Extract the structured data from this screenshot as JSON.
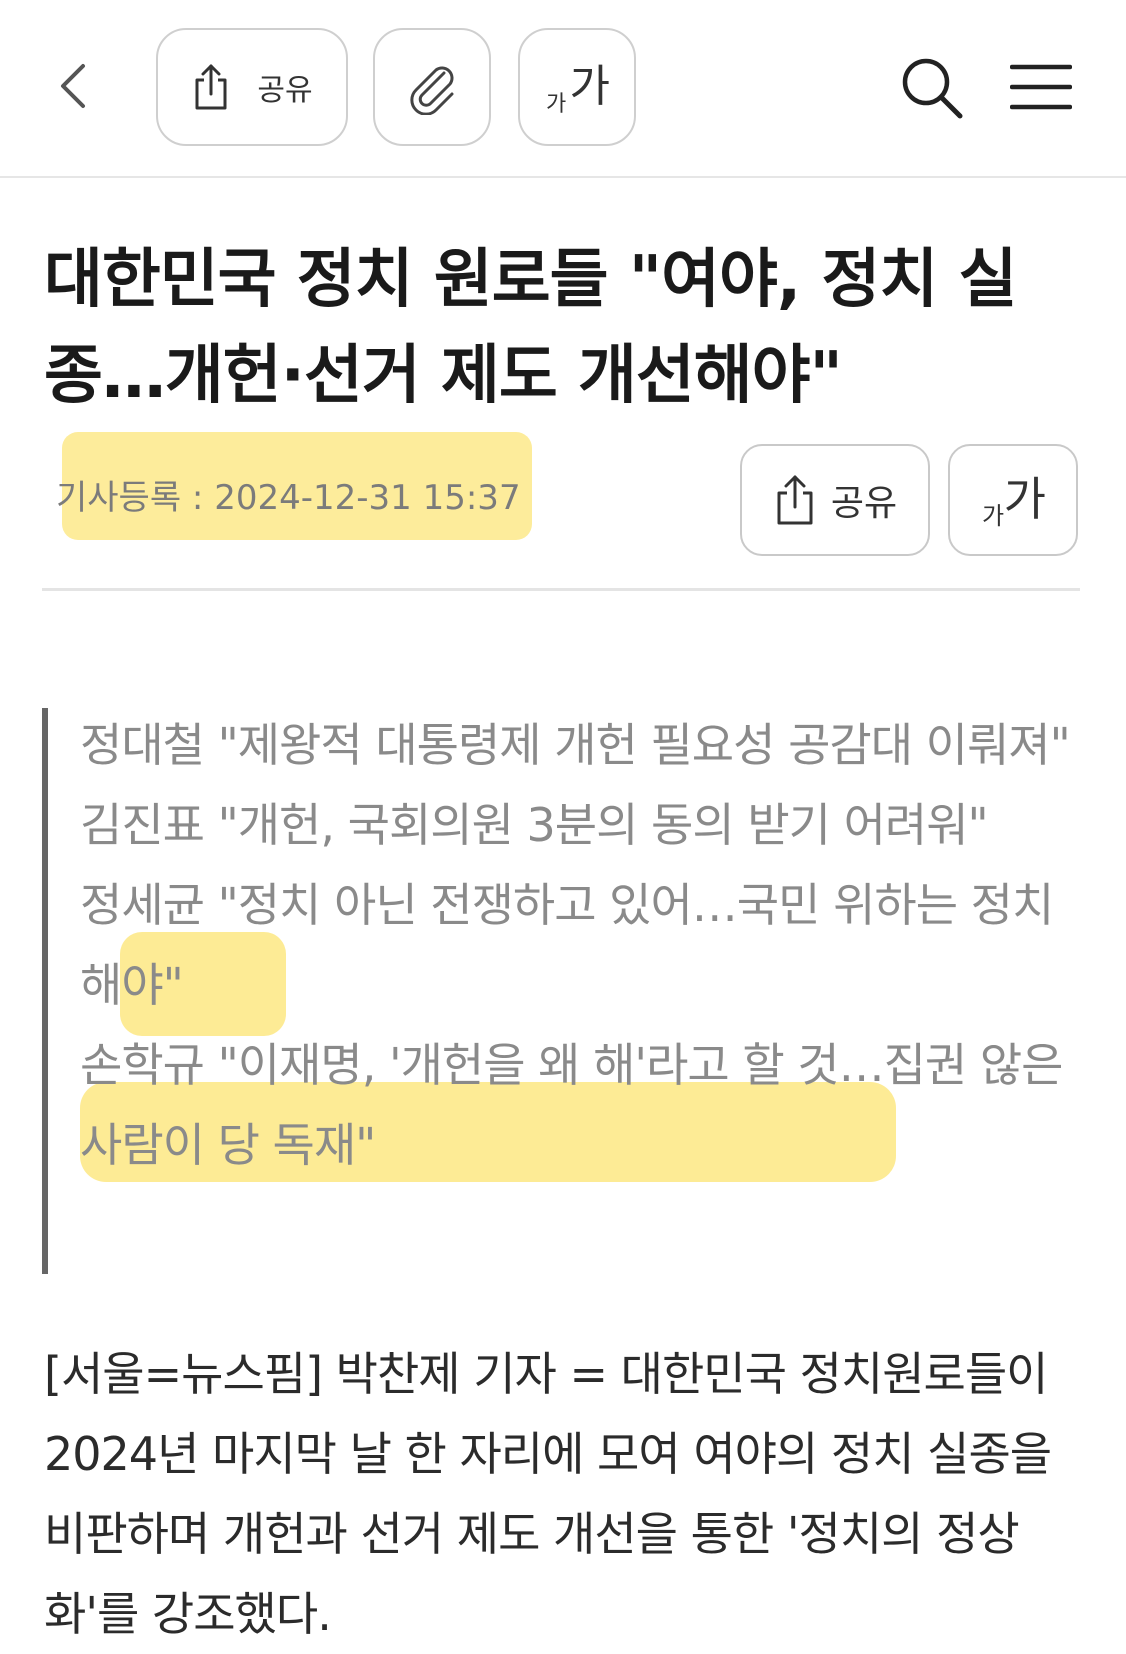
{
  "toolbar": {
    "share_label": "공유",
    "font_small": "가",
    "font_big": "가"
  },
  "article": {
    "headline": "대한민국 정치 원로들 \"여야, 정치 실종…개헌·선거 제도 개선해야\"",
    "date_line": "기사등록 : 2024-12-31 15:37",
    "share_label": "공유",
    "font_small": "가",
    "font_big": "가",
    "summary": [
      "정대철 \"제왕적 대통령제 개헌 필요성 공감대 이뤄져\"",
      "김진표 \"개헌, 국회의원 3분의 동의 받기 어려워\"",
      "정세균 \"정치 아닌 전쟁하고 있어…국민 위하는 정치해야\"",
      "손학규 \"이재명, '개헌을 왜 해'라고 할 것…집권 않은 사람이 당 독재\""
    ],
    "body": "[서울=뉴스핌] 박찬제 기자 = 대한민국 정치원로들이 2024년 마지막 날 한 자리에 모여 여야의 정치 실종을 비판하며 개헌과 선거 제도 개선을 통한 '정치의 정상화'를 강조했다."
  },
  "colors": {
    "highlight": "#fde98a",
    "border": "#cfcfcf",
    "summary_text": "#8a8a8a"
  },
  "icons": [
    "back-chevron-icon",
    "share-icon",
    "paperclip-icon",
    "font-size-icon",
    "search-icon",
    "menu-icon"
  ]
}
